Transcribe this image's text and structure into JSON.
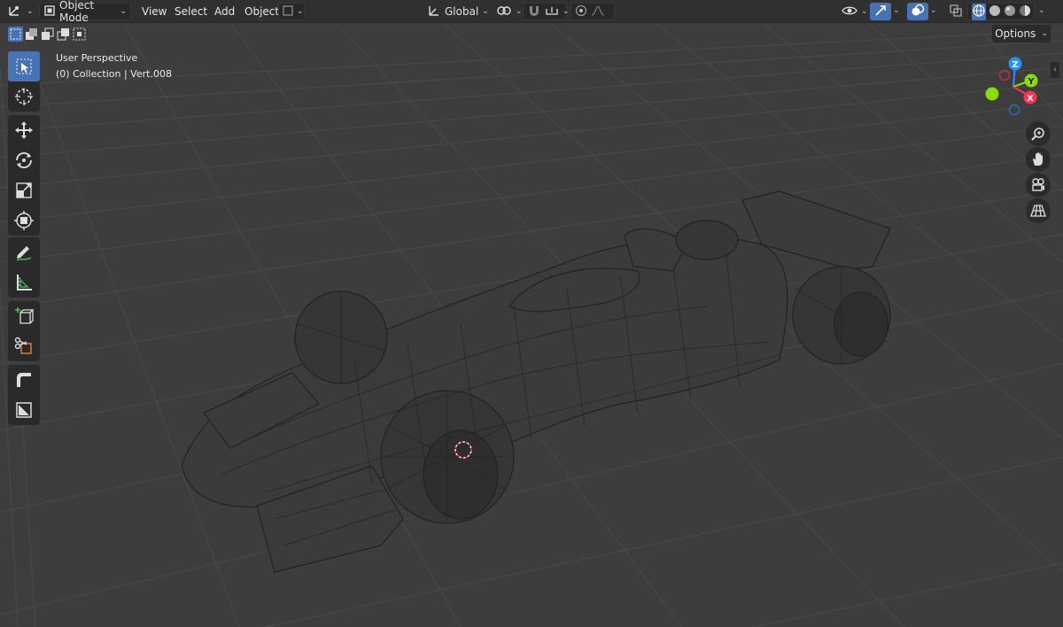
{
  "header": {
    "mode_label": "Object Mode",
    "menus": [
      "View",
      "Select",
      "Add",
      "Object"
    ],
    "transform_orientation": "Global"
  },
  "viewport": {
    "view_name": "User Perspective",
    "collection_info": "(0) Collection | Vert.008",
    "options_label": "Options"
  },
  "gizmo": {
    "z": "Z",
    "y": "Y",
    "x": "X"
  },
  "icons": {
    "editor_type": "cursor-axis-icon",
    "mode": "object-mode-icon",
    "snap": "magnet-icon",
    "proportional": "proportional-edit-icon"
  },
  "colors": {
    "accent": "#4772b3",
    "x_axis": "#ff3352",
    "y_axis": "#8bdc00",
    "z_axis": "#2890ff"
  }
}
